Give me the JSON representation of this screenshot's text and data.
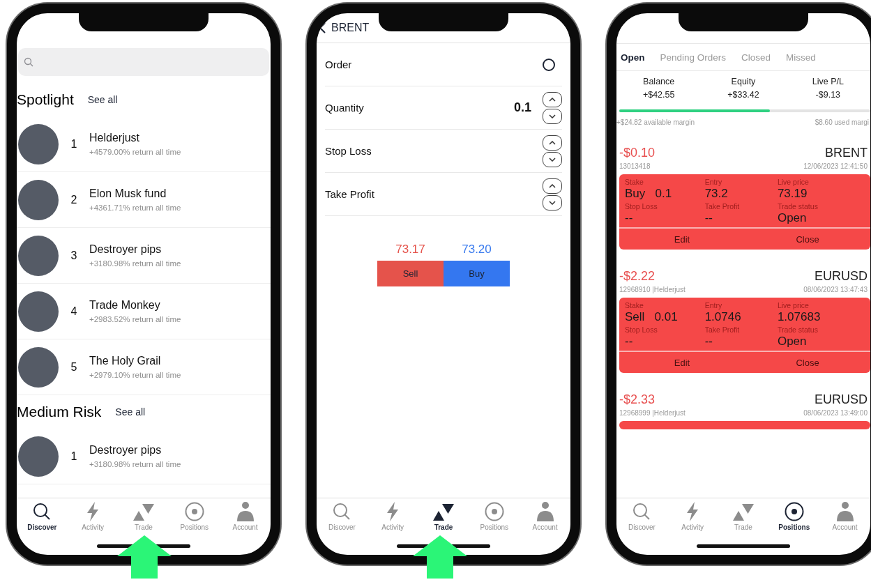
{
  "phones": [
    {
      "kind": "discover",
      "highlight_arrow": true,
      "sections": [
        {
          "title": "Spotlight",
          "link": "See all",
          "traders": [
            {
              "rank": "1",
              "name": "Helderjust",
              "return": "+4579.00% return all time"
            },
            {
              "rank": "2",
              "name": "Elon Musk fund",
              "return": "+4361.71% return all time"
            },
            {
              "rank": "3",
              "name": "Destroyer pips",
              "return": "+3180.98% return all time"
            },
            {
              "rank": "4",
              "name": "Trade Monkey",
              "return": "+2983.52% return all time"
            },
            {
              "rank": "5",
              "name": "The Holy Grail",
              "return": "+2979.10% return all time"
            }
          ]
        },
        {
          "title": "Medium Risk",
          "link": "See all",
          "traders": [
            {
              "rank": "1",
              "name": "Destroyer pips",
              "return": "+3180.98% return all time"
            }
          ]
        }
      ],
      "tabs": [
        {
          "label": "Discover",
          "selected": true
        },
        {
          "label": "Activity",
          "selected": false
        },
        {
          "label": "Trade",
          "selected": false
        },
        {
          "label": "Positions",
          "selected": false
        },
        {
          "label": "Account",
          "selected": false
        }
      ]
    },
    {
      "kind": "trade",
      "highlight_arrow": true,
      "back_label": "BRENT",
      "fields": [
        {
          "kind": "toggle",
          "label": "Order",
          "on": false
        },
        {
          "kind": "stepper",
          "label": "Quantity",
          "value": "0.1"
        },
        {
          "kind": "stepper",
          "label": "Stop Loss"
        },
        {
          "kind": "stepper",
          "label": "Take Profit"
        }
      ],
      "sell_price": "73.17",
      "buy_price": "73.20",
      "sell_button": "Sell",
      "buy_button": "Buy",
      "tabs": [
        {
          "label": "Discover",
          "selected": false
        },
        {
          "label": "Activity",
          "selected": false
        },
        {
          "label": "Trade",
          "selected": true
        },
        {
          "label": "Positions",
          "selected": false
        },
        {
          "label": "Account",
          "selected": false
        }
      ]
    },
    {
      "kind": "positions",
      "highlight_arrow": false,
      "position_tabs": [
        {
          "label": "Open",
          "selected": true
        },
        {
          "label": "Pending Orders",
          "selected": false
        },
        {
          "label": "Closed",
          "selected": false
        },
        {
          "label": "Missed",
          "selected": false
        }
      ],
      "summary": [
        {
          "label": "Balance",
          "value": "+$42.55"
        },
        {
          "label": "Equity",
          "value": "+$33.42"
        },
        {
          "label": "Live P/L",
          "value": "-$9.13"
        }
      ],
      "margin": {
        "level": 0.6,
        "available": "+$24.82 available margin",
        "used": "$8.60 used margi"
      },
      "positions": [
        {
          "pl": "-$0.10",
          "symbol": "BRENT",
          "ref": "13013418",
          "time": "12/06/2023 12:41:50",
          "cells": [
            {
              "label": "Stake",
              "value": "Buy   0.1"
            },
            {
              "label": "Entry",
              "value": "73.2"
            },
            {
              "label": "Live price",
              "value": "73.19"
            },
            {
              "label": "Stop Loss",
              "value": "--"
            },
            {
              "label": "Take Profit",
              "value": "--"
            },
            {
              "label": "Trade status",
              "value": "Open"
            }
          ],
          "actions": [
            "Edit",
            "Close"
          ]
        },
        {
          "pl": "-$2.22",
          "symbol": "EURUSD",
          "ref": "12968910 |Helderjust",
          "time": "08/06/2023 13:47:43",
          "cells": [
            {
              "label": "Stake",
              "value": "Sell   0.01"
            },
            {
              "label": "Entry",
              "value": "1.0746"
            },
            {
              "label": "Live price",
              "value": "1.07683"
            },
            {
              "label": "Stop Loss",
              "value": "--"
            },
            {
              "label": "Take Profit",
              "value": "--"
            },
            {
              "label": "Trade status",
              "value": "Open"
            }
          ],
          "actions": [
            "Edit",
            "Close"
          ]
        },
        {
          "pl": "-$2.33",
          "symbol": "EURUSD",
          "ref": "12968999 |Helderjust",
          "time": "08/06/2023 13:49:00"
        }
      ],
      "tabs": [
        {
          "label": "Discover",
          "selected": false
        },
        {
          "label": "Activity",
          "selected": false
        },
        {
          "label": "Trade",
          "selected": false
        },
        {
          "label": "Positions",
          "selected": true
        },
        {
          "label": "Account",
          "selected": false
        }
      ]
    }
  ]
}
